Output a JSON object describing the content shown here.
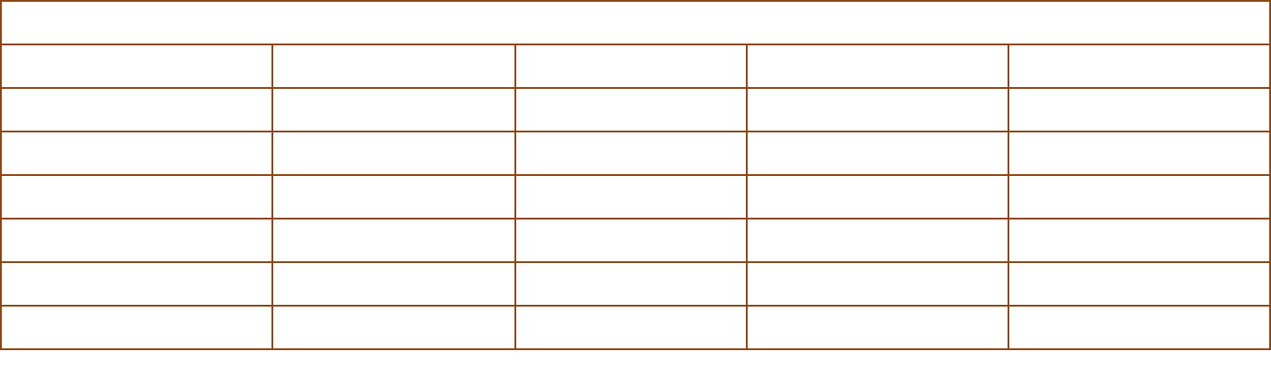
{
  "colors": {
    "border": "#8b4513",
    "background": "#ffffff"
  },
  "table": {
    "header": "",
    "rows": [
      [
        "",
        "",
        "",
        "",
        ""
      ],
      [
        "",
        "",
        "",
        "",
        ""
      ],
      [
        "",
        "",
        "",
        "",
        ""
      ],
      [
        "",
        "",
        "",
        "",
        ""
      ],
      [
        "",
        "",
        "",
        "",
        ""
      ],
      [
        "",
        "",
        "",
        "",
        ""
      ],
      [
        "",
        "",
        "",
        "",
        ""
      ]
    ]
  }
}
